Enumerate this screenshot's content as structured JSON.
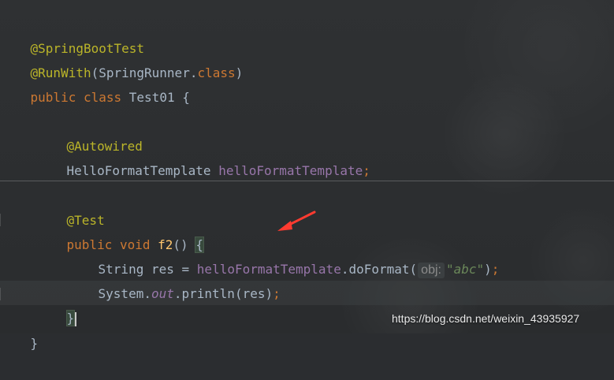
{
  "editor": {
    "lines": {
      "line1": "@SpringBootTest",
      "line2_annotation": "@RunWith",
      "line2_args": "(SpringRunner.",
      "line2_class": "class",
      "line2_close": ")",
      "line3_public": "public",
      "line3_class": "class",
      "line3_name": "Test01",
      "line3_brace": "{",
      "line5": "@Autowired",
      "line6_type": "HelloFormatTemplate",
      "line6_field": "helloFormatTemplate",
      "line6_semicolon": ";",
      "line8": "@Test",
      "line9_public": "public",
      "line9_void": "void",
      "line9_name": "f2",
      "line9_parens": "()",
      "line9_brace": "{",
      "line10_type": "String",
      "line10_var": "res",
      "line10_eq": "=",
      "line10_field": "helloFormatTemplate",
      "line10_dot": ".",
      "line10_method": "doFormat",
      "line10_open": "(",
      "line10_hint": "obj:",
      "line10_string": "\"abc\"",
      "line10_close": ")",
      "line10_semicolon": ";",
      "line11_system": "System",
      "line11_dot": ".",
      "line11_out": "out",
      "line11_println": ".println(res)",
      "line11_semicolon": ";",
      "line12_brace": "}",
      "line13_brace": "}"
    },
    "colors": {
      "background": "#2b2d30",
      "annotation": "#bbb529",
      "keyword": "#cc7832",
      "field": "#9876aa",
      "string": "#6a8759",
      "text": "#a9b7c6"
    }
  },
  "annotation": {
    "arrow_color": "#ff3b30",
    "arrow_icon": "arrow-icon"
  },
  "watermark": {
    "text": "https://blog.csdn.net/weixin_43935927"
  }
}
